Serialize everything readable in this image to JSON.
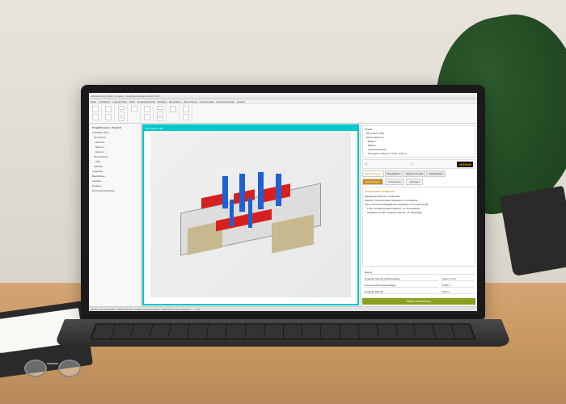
{
  "window": {
    "title": "Autodesk Revit 2023 - Projekt1 - Dreidimensionale Ansicht: {3D}"
  },
  "menu": {
    "items": [
      "Datei",
      "Architektur",
      "Ingenieurbau",
      "Stahl",
      "Gebäudetechnik",
      "Einfügen",
      "Beschriften",
      "Berechnung",
      "Körpermodell",
      "Zusammenarbeit",
      "Ansicht",
      "Verwalten",
      "Zusatzmodule",
      "Ändern"
    ]
  },
  "browser": {
    "title": "Projektbrowser - Projekt1",
    "items": [
      "Ansichten (alle)",
      "Grundrisse",
      "Ebene 0",
      "Ebene 1",
      "Ebene 2",
      "3D-Ansichten",
      "{3D}",
      "Schnitte",
      "Legenden",
      "Bauteillisten",
      "Familien",
      "Gruppen",
      "Revit-Verknüpfungen"
    ]
  },
  "viewport": {
    "label": "3D-Ansicht: {3D}"
  },
  "right": {
    "tree": [
      "Projekt",
      "3D-Ansicht: {3D}",
      "Ebene: Ebene 0",
      "Räume",
      "Wände",
      "Geschossdecken",
      "Montagen im Raum H 3,00 - 3,50 m"
    ],
    "brand": "DBDBIM",
    "tabs": [
      "Bauteilvorlagen",
      "Bauteildaten",
      "Eigenes Projekt",
      "Klassifikation"
    ],
    "actions": {
      "configure": "Konfigurieren",
      "favorites": "zu Favoriten",
      "assign": "Anzeigen"
    },
    "group_title": "Innenwandkonstruktionen",
    "lines": [
      "Wandkonstruktionen Trockenbau",
      "Wände / Vorsatzschalen Gipskarton-Trennwände",
      "Innen-Trennbau-Metallständer-Gipskarton-Trennwände AB",
      "F 90-4 einfach/einfach beplannt / st. Mineralwolle",
      "Gipskarton FI 90 / doppelte Ständer / st. Mineraldg."
    ],
    "table": [
      {
        "label": "Bauteil",
        "val": ""
      },
      {
        "label": "Doppelte Ständer-Schichtaufbau",
        "val": "System 1,0 A"
      },
      {
        "label": "Gew-Gerechnungsgrundlage",
        "val": "0,226 m"
      },
      {
        "label": "Doppelte Ständer",
        "val": "3,00 m"
      }
    ],
    "main_button": "Daten übernehmen"
  },
  "status": {
    "text": "Klicken zum Auswählen, TAB für andere, STRG zum Hinzufügen, UMSCHALT zum Aufheben — 1:100"
  }
}
